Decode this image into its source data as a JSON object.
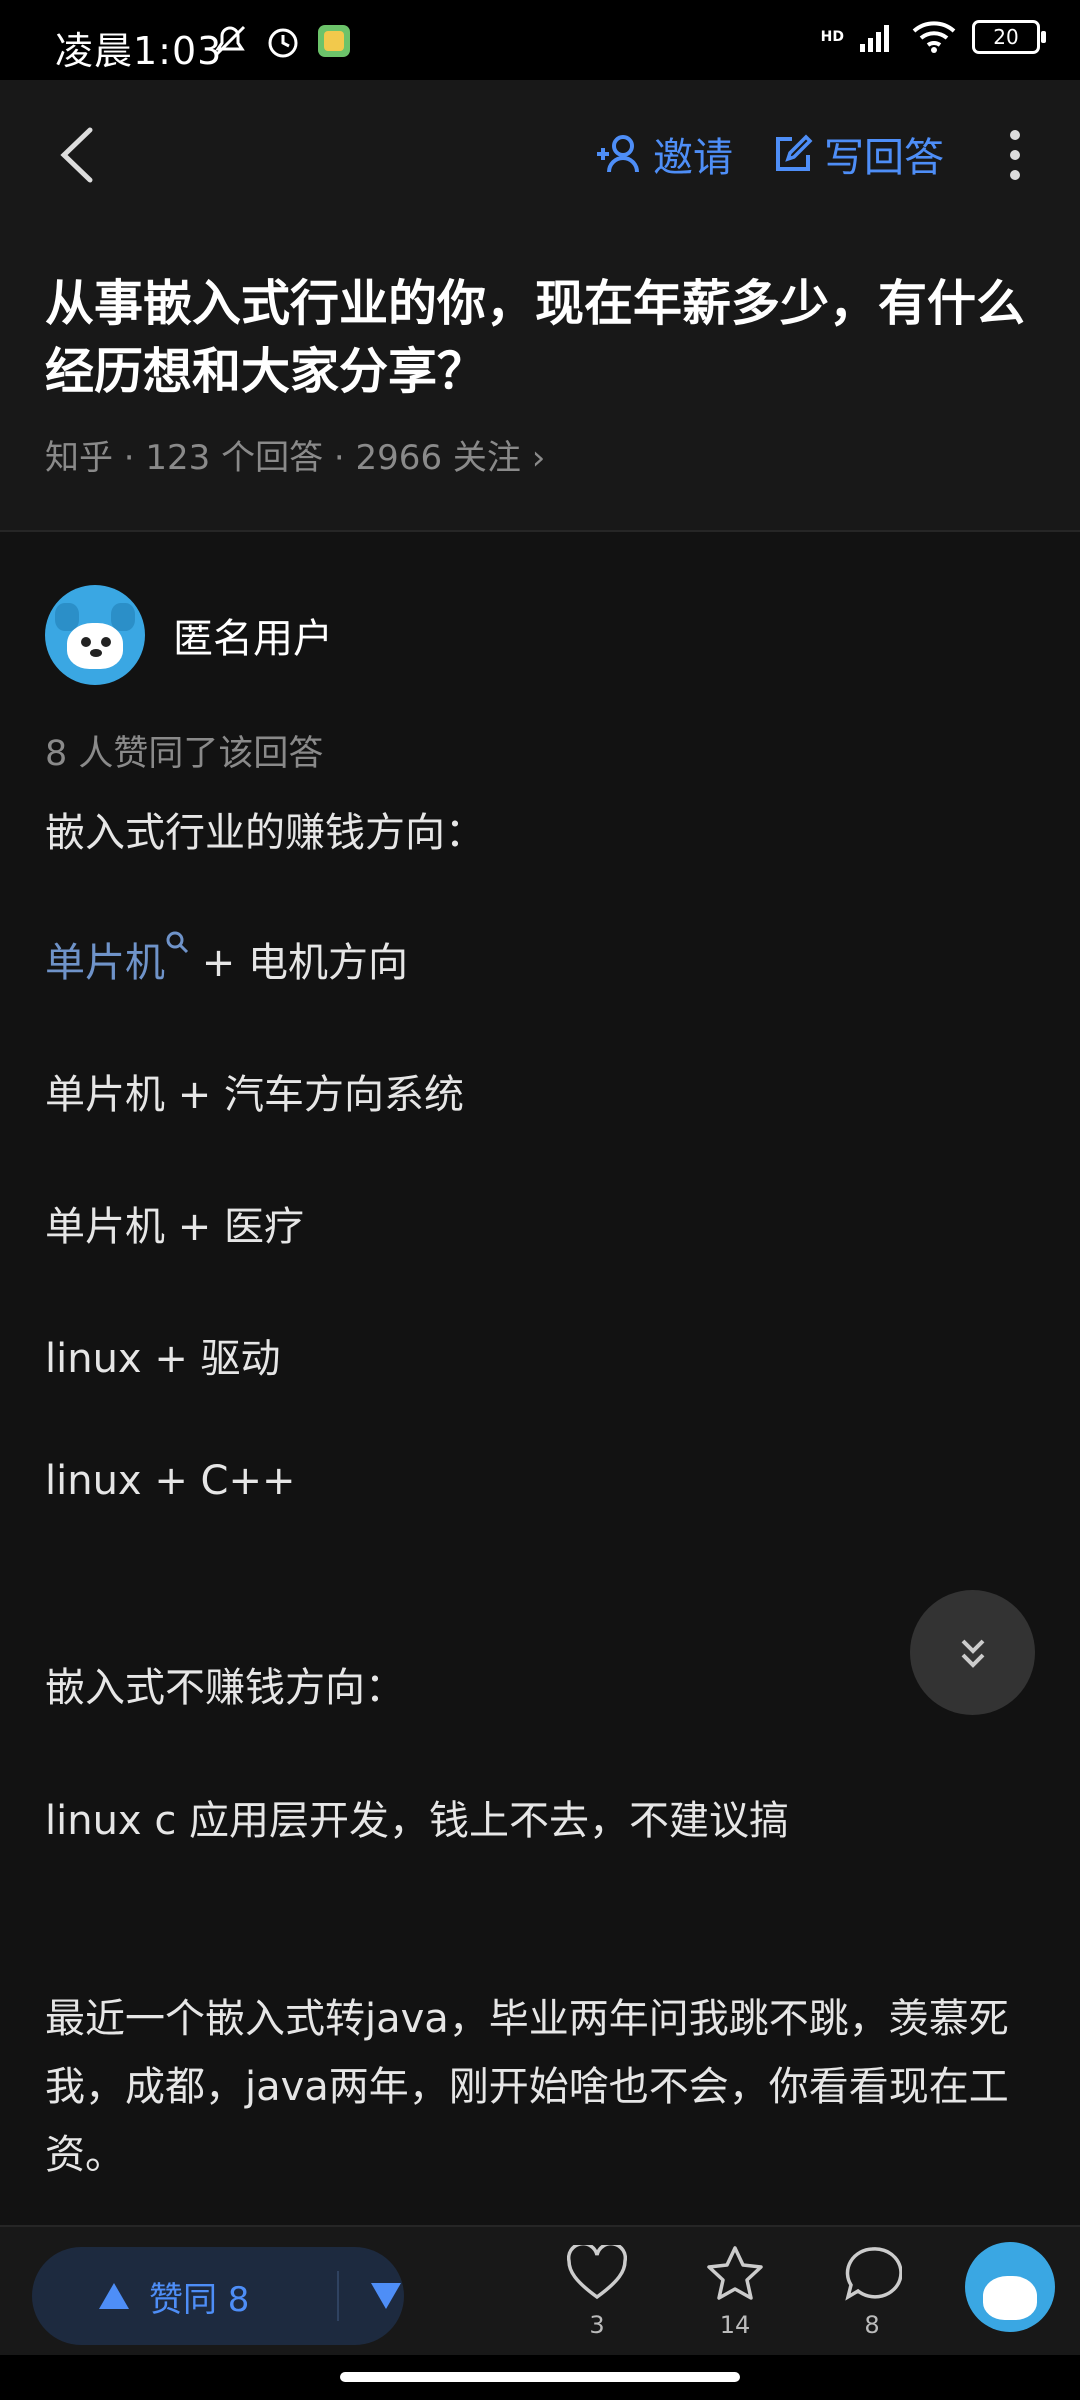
{
  "status_bar": {
    "time": "凌晨1:03",
    "network_label": "HD",
    "battery": "20"
  },
  "top_bar": {
    "invite_label": "邀请",
    "write_label": "写回答"
  },
  "question": {
    "title": "从事嵌入式行业的你，现在年薪多少，有什么经历想和大家分享？",
    "meta": "知乎 · 123 个回答 · 2966 关注 ›"
  },
  "answer": {
    "author": "匿名用户",
    "votes_text": "8 人赞同了该回答",
    "paragraphs": [
      "嵌入式行业的赚钱方向：",
      "单片机",
      " + 电机方向",
      "单片机 + 汽车方向系统",
      "单片机 + 医疗",
      "linux + 驱动",
      "linux + C++",
      "嵌入式不赚钱方向：",
      "linux c 应用层开发，钱上不去，不建议搞",
      "最近一个嵌入式转java，毕业两年问我跳不跳，羡慕死我，成都，java两年，刚开始啥也不会，你看看现在工资。"
    ]
  },
  "bottom_bar": {
    "upvote_label": "赞同 8",
    "like_count": "3",
    "favorite_count": "14",
    "comment_count": "8"
  },
  "colors": {
    "accent": "#4e8ef7",
    "link": "#6f93c9",
    "background": "#121212"
  }
}
